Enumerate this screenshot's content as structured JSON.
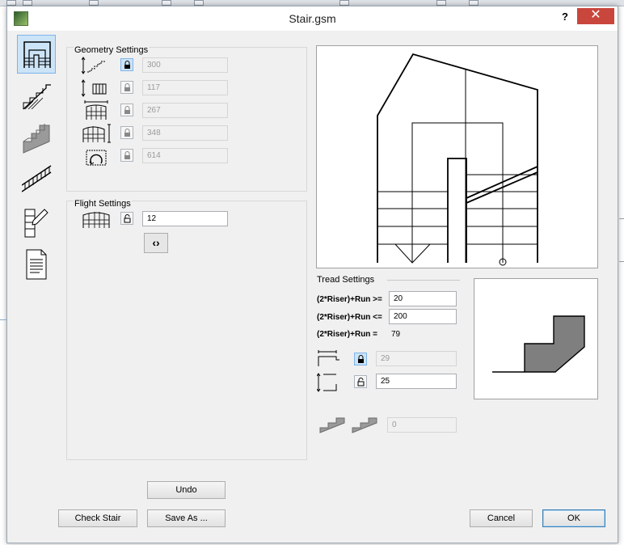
{
  "window": {
    "title": "Stair.gsm",
    "help_label": "?",
    "close_label": "✕"
  },
  "sidebar": {
    "tabs": [
      {
        "name": "geometry-tab",
        "icon": "stair-plan-icon",
        "active": true
      },
      {
        "name": "structure-tab",
        "icon": "stair-section-icon",
        "active": false
      },
      {
        "name": "finish-tab",
        "icon": "stair-tread-3d-icon",
        "active": false
      },
      {
        "name": "railing-tab",
        "icon": "railing-icon",
        "active": false
      },
      {
        "name": "symbol-tab",
        "icon": "plan-symbol-icon",
        "active": false
      },
      {
        "name": "listing-tab",
        "icon": "document-icon",
        "active": false
      }
    ]
  },
  "geometry": {
    "title": "Geometry Settings",
    "rows": [
      {
        "icon": "total-height-icon",
        "locked": true,
        "value": "300",
        "disabled": true
      },
      {
        "icon": "riser-count-icon",
        "locked": false,
        "value": "117",
        "disabled": true
      },
      {
        "icon": "stair-width-icon",
        "locked": false,
        "value": "267",
        "disabled": true
      },
      {
        "icon": "stair-length-icon",
        "locked": false,
        "value": "348",
        "disabled": true
      },
      {
        "icon": "stair-turn-icon",
        "locked": false,
        "value": "614",
        "disabled": true
      }
    ]
  },
  "flight": {
    "title": "Flight Settings",
    "icon": "flight-icon",
    "locked": false,
    "value": "12",
    "stepper_label": "‹›"
  },
  "tread": {
    "title": "Tread Settings",
    "min_label": "(2*Riser)+Run >=",
    "min_value": "20",
    "max_label": "(2*Riser)+Run <=",
    "max_value": "200",
    "eq_label": "(2*Riser)+Run =",
    "eq_value": "79",
    "run_value": "29",
    "run_locked": true,
    "riser_value": "25",
    "riser_locked": false,
    "nosing_value": "0"
  },
  "buttons": {
    "undo": "Undo",
    "check": "Check Stair",
    "save_as": "Save As ...",
    "cancel": "Cancel",
    "ok": "OK"
  },
  "colors": {
    "accent": "#3c7fb1",
    "close": "#c9463d",
    "panel": "#f0f0f0",
    "active_tab": "#cce4f7"
  }
}
